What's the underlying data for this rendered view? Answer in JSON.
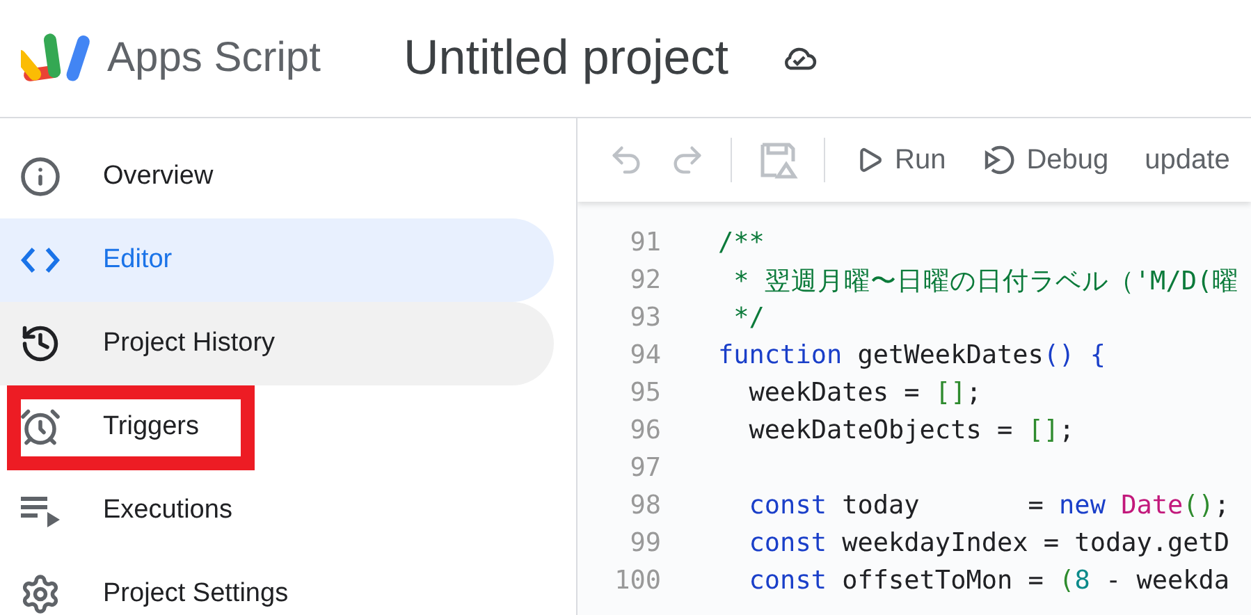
{
  "header": {
    "app_name": "Apps Script",
    "project_title": "Untitled project"
  },
  "sidebar": {
    "items": [
      {
        "label": "Overview",
        "selected": false,
        "hovered": false,
        "highlighted": false
      },
      {
        "label": "Editor",
        "selected": true,
        "hovered": false,
        "highlighted": false
      },
      {
        "label": "Project History",
        "selected": false,
        "hovered": true,
        "highlighted": false
      },
      {
        "label": "Triggers",
        "selected": false,
        "hovered": false,
        "highlighted": true
      },
      {
        "label": "Executions",
        "selected": false,
        "hovered": false,
        "highlighted": false
      },
      {
        "label": "Project Settings",
        "selected": false,
        "hovered": false,
        "highlighted": false
      }
    ]
  },
  "toolbar": {
    "undo": {
      "disabled": true
    },
    "redo": {
      "disabled": true
    },
    "save": {
      "disabled": true
    },
    "run": {
      "label": "Run"
    },
    "debug": {
      "label": "Debug"
    },
    "function_select": {
      "value": "update"
    }
  },
  "code": {
    "lines": [
      {
        "number": "91",
        "tokens": [
          {
            "text": "/**",
            "kind": "comment"
          }
        ]
      },
      {
        "number": "92",
        "tokens": [
          {
            "text": " * 翌週月曜〜日曜の日付ラベル（'M/D(曜",
            "kind": "comment"
          }
        ]
      },
      {
        "number": "93",
        "tokens": [
          {
            "text": " */",
            "kind": "comment"
          }
        ]
      },
      {
        "number": "94",
        "tokens": [
          {
            "text": "function",
            "kind": "keyword"
          },
          {
            "text": " getWeekDates",
            "kind": "plain"
          },
          {
            "text": "()",
            "kind": "paren"
          },
          {
            "text": " {",
            "kind": "paren"
          }
        ]
      },
      {
        "number": "95",
        "tokens": [
          {
            "text": "  weekDates = ",
            "kind": "plain"
          },
          {
            "text": "[]",
            "kind": "bracket"
          },
          {
            "text": ";",
            "kind": "plain"
          }
        ]
      },
      {
        "number": "96",
        "tokens": [
          {
            "text": "  weekDateObjects = ",
            "kind": "plain"
          },
          {
            "text": "[]",
            "kind": "bracket"
          },
          {
            "text": ";",
            "kind": "plain"
          }
        ]
      },
      {
        "number": "97"
      },
      {
        "number": "98",
        "tokens": [
          {
            "text": "  const",
            "kind": "keyword"
          },
          {
            "text": " today       = ",
            "kind": "plain"
          },
          {
            "text": "new",
            "kind": "keyword"
          },
          {
            "text": " Date",
            "kind": "class"
          },
          {
            "text": "()",
            "kind": "bracket"
          },
          {
            "text": ";",
            "kind": "plain"
          }
        ]
      },
      {
        "number": "99",
        "tokens": [
          {
            "text": "  const",
            "kind": "keyword"
          },
          {
            "text": " weekdayIndex = today.getD",
            "kind": "plain"
          }
        ]
      },
      {
        "number": "100",
        "tokens": [
          {
            "text": "  const",
            "kind": "keyword"
          },
          {
            "text": " offsetToMon = ",
            "kind": "plain"
          },
          {
            "text": "(",
            "kind": "bracket"
          },
          {
            "text": "8",
            "kind": "number"
          },
          {
            "text": " - weekda",
            "kind": "plain"
          }
        ]
      }
    ]
  }
}
